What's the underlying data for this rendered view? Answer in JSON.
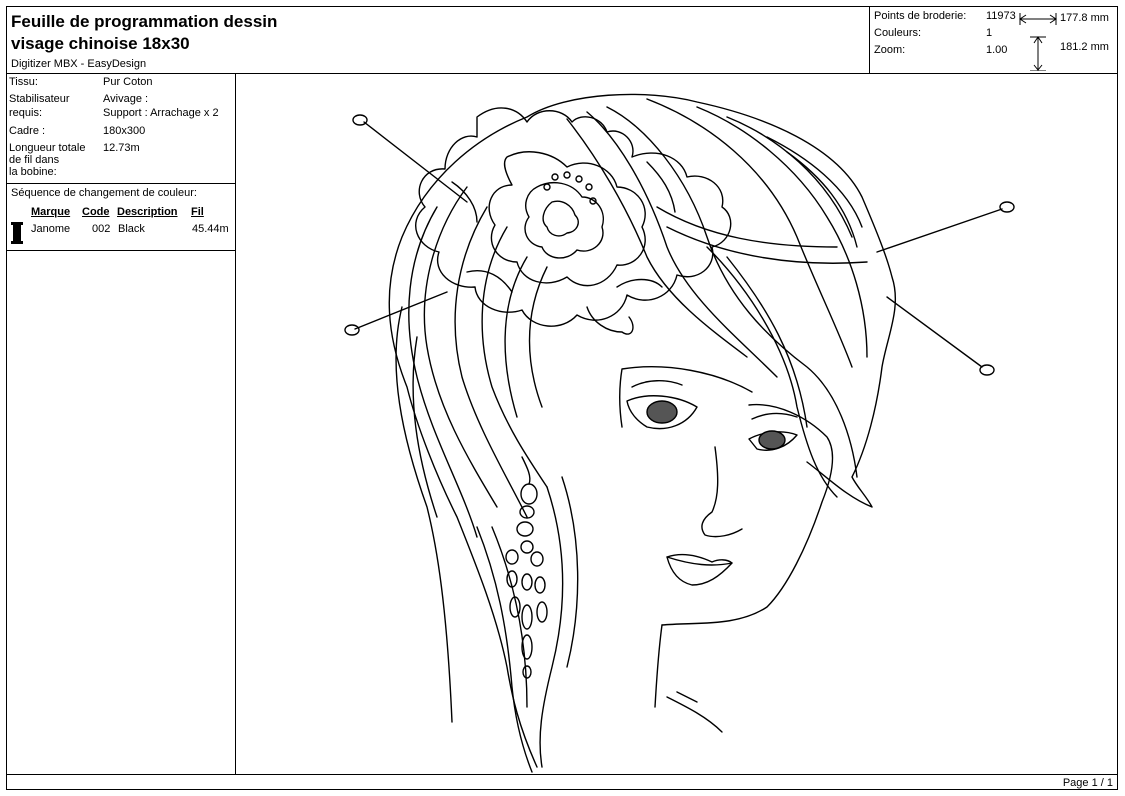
{
  "header": {
    "title_line1": "Feuille de programmation dessin",
    "title_line2": "visage chinoise 18x30",
    "software": "Digitizer MBX - EasyDesign"
  },
  "stats": {
    "stitches_label": "Points de broderie:",
    "stitches_value": "11973",
    "colors_label": "Couleurs:",
    "colors_value": "1",
    "zoom_label": "Zoom:",
    "zoom_value": "1.00",
    "width": "177.8 mm",
    "height": "181.2 mm"
  },
  "info": {
    "fabric_label": "Tissu:",
    "fabric_value": "Pur Coton",
    "stabilizer_label_1": "Stabilisateur",
    "stabilizer_label_2": "requis:",
    "stabilizer_value_1": "Avivage :",
    "stabilizer_value_2": "Support : Arrachage x 2",
    "frame_label": "Cadre :",
    "frame_value": "180x300",
    "thread_label_1": "Longueur totale",
    "thread_label_2": "de fil dans",
    "thread_label_3": "la bobine:",
    "thread_value": "12.73m"
  },
  "sequence": {
    "title": "Séquence de changement de couleur:",
    "columns": [
      "Marque",
      "Code",
      "Description",
      "Fil"
    ],
    "rows": [
      {
        "brand": "Janome",
        "code": "002",
        "description": "Black",
        "thread": "45.44m"
      }
    ]
  },
  "footer": {
    "page": "Page 1 / 1"
  },
  "colors": {
    "border": "#000000",
    "background": "#ffffff",
    "thread_black": "#000000"
  }
}
